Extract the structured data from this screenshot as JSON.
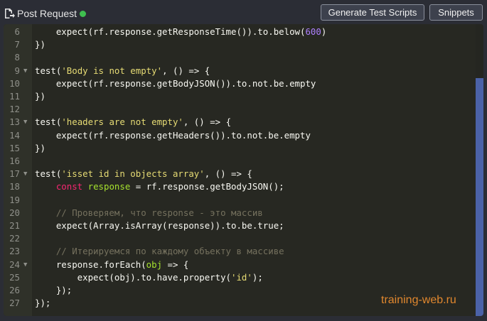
{
  "header": {
    "title": "Post Request",
    "generate_label": "Generate Test Scripts",
    "snippets_label": "Snippets"
  },
  "editor": {
    "lines": [
      {
        "num": "6",
        "fold": false,
        "tokens": [
          {
            "t": "    expect(rf.response.getResponseTime()).to.below("
          },
          {
            "t": "600",
            "c": "num"
          },
          {
            "t": ")"
          }
        ]
      },
      {
        "num": "7",
        "fold": false,
        "tokens": [
          {
            "t": "})"
          }
        ]
      },
      {
        "num": "8",
        "fold": false,
        "tokens": []
      },
      {
        "num": "9",
        "fold": true,
        "tokens": [
          {
            "t": "test("
          },
          {
            "t": "'Body is not empty'",
            "c": "str"
          },
          {
            "t": ", () => {"
          }
        ]
      },
      {
        "num": "10",
        "fold": false,
        "tokens": [
          {
            "t": "    expect(rf.response.getBodyJSON()).to.not.be.empty"
          }
        ]
      },
      {
        "num": "11",
        "fold": false,
        "tokens": [
          {
            "t": "})"
          }
        ]
      },
      {
        "num": "12",
        "fold": false,
        "tokens": []
      },
      {
        "num": "13",
        "fold": true,
        "tokens": [
          {
            "t": "test("
          },
          {
            "t": "'headers are not empty'",
            "c": "str"
          },
          {
            "t": ", () => {"
          }
        ]
      },
      {
        "num": "14",
        "fold": false,
        "tokens": [
          {
            "t": "    expect(rf.response.getHeaders()).to.not.be.empty"
          }
        ]
      },
      {
        "num": "15",
        "fold": false,
        "tokens": [
          {
            "t": "})"
          }
        ]
      },
      {
        "num": "16",
        "fold": false,
        "tokens": []
      },
      {
        "num": "17",
        "fold": true,
        "tokens": [
          {
            "t": "test("
          },
          {
            "t": "'isset id in objects array'",
            "c": "str"
          },
          {
            "t": ", () => {"
          }
        ]
      },
      {
        "num": "18",
        "fold": false,
        "tokens": [
          {
            "t": "    "
          },
          {
            "t": "const",
            "c": "kw"
          },
          {
            "t": " "
          },
          {
            "t": "response",
            "c": "fn"
          },
          {
            "t": " = rf.response.getBodyJSON();"
          }
        ]
      },
      {
        "num": "19",
        "fold": false,
        "tokens": []
      },
      {
        "num": "20",
        "fold": false,
        "tokens": [
          {
            "t": "    // Проверяем, что response - это массив",
            "c": "cm"
          }
        ]
      },
      {
        "num": "21",
        "fold": false,
        "tokens": [
          {
            "t": "    expect(Array.isArray(response)).to.be.true;"
          }
        ]
      },
      {
        "num": "22",
        "fold": false,
        "tokens": []
      },
      {
        "num": "23",
        "fold": false,
        "tokens": [
          {
            "t": "    // Итерируемся по каждому объекту в массиве",
            "c": "cm"
          }
        ]
      },
      {
        "num": "24",
        "fold": true,
        "tokens": [
          {
            "t": "    response.forEach("
          },
          {
            "t": "obj",
            "c": "fn"
          },
          {
            "t": " => {"
          }
        ]
      },
      {
        "num": "25",
        "fold": false,
        "tokens": [
          {
            "t": "        expect(obj).to.have.property("
          },
          {
            "t": "'id'",
            "c": "str"
          },
          {
            "t": ");"
          }
        ]
      },
      {
        "num": "26",
        "fold": false,
        "tokens": [
          {
            "t": "    });"
          }
        ]
      },
      {
        "num": "27",
        "fold": false,
        "tokens": [
          {
            "t": "});"
          }
        ]
      }
    ]
  },
  "watermark": "training-web.ru",
  "colors": {
    "keyword": "#f92672",
    "string": "#e6db74",
    "number": "#ae81ff",
    "param": "#a6e22e",
    "comment": "#75715e",
    "status": "#3fbf4f",
    "scroll_thumb": "#4b62a8",
    "watermark": "#e0872e"
  }
}
